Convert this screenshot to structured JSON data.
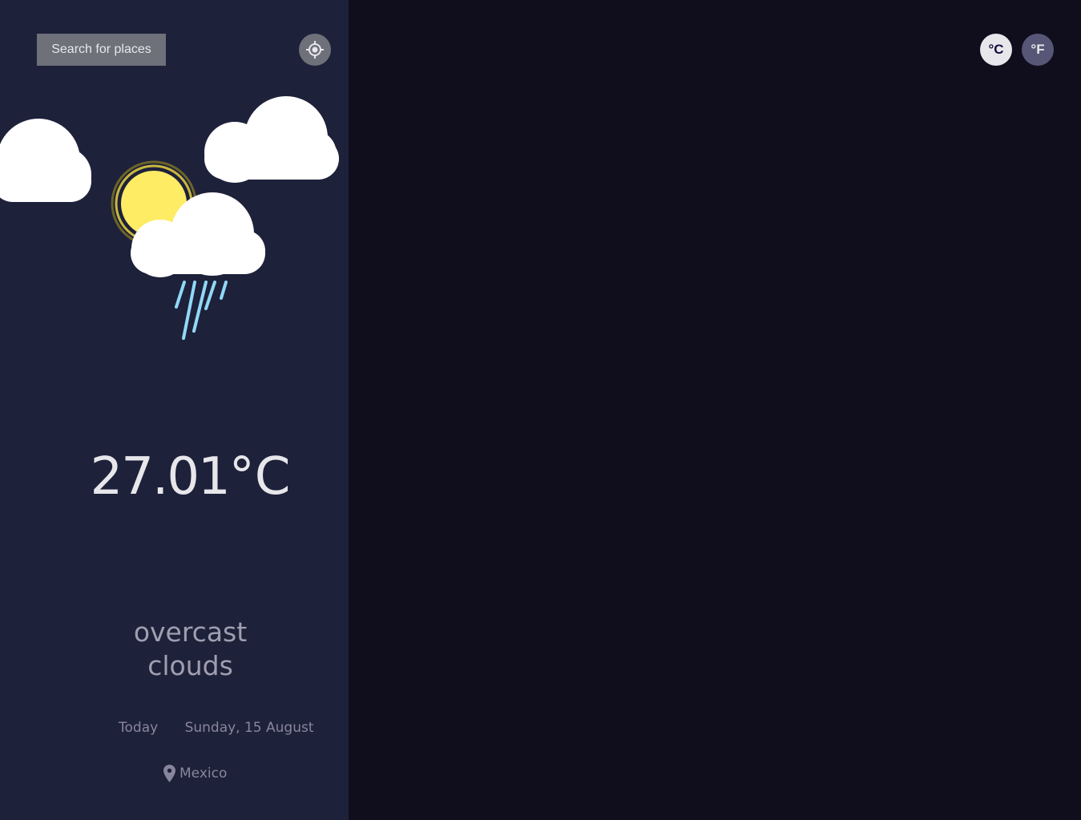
{
  "sidebar": {
    "search_label": "Search for places",
    "locate_icon": "crosshair-gps-icon",
    "weather_icon": "partly-cloudy-rain-icon",
    "temperature_value": "27.01",
    "temperature_unit": "°C",
    "description_line1": "overcast",
    "description_line2": "clouds",
    "today_label": "Today",
    "date_label": "Sunday, 15 August",
    "location_icon": "map-pin-icon",
    "location": "Mexico"
  },
  "units": {
    "celsius_label": "°C",
    "fahrenheit_label": "°F",
    "selected": "celsius"
  },
  "colors": {
    "sidebar_bg": "#1e213a",
    "main_bg": "#100e1d",
    "button_gray": "#6e707a",
    "sun_yellow": "#ffec65",
    "rain_blue": "#91d8f7",
    "text_light": "#e7e7eb",
    "text_muted": "#a09fb1",
    "unit_active_bg": "#e7e7eb",
    "unit_inactive_bg": "#585676"
  }
}
